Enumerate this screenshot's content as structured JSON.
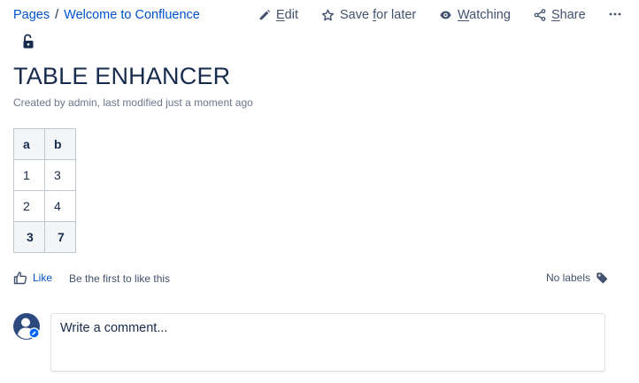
{
  "breadcrumb": {
    "root": "Pages",
    "separator": "/",
    "parent": "Welcome to Confluence"
  },
  "actions": {
    "edit": {
      "icon": "pencil-icon",
      "prefix": "",
      "underline": "E",
      "suffix": "dit"
    },
    "save": {
      "icon": "star-icon",
      "prefix": "Save ",
      "underline": "f",
      "suffix": "or later"
    },
    "watch": {
      "icon": "eye-icon",
      "prefix": "",
      "underline": "W",
      "suffix": "atching"
    },
    "share": {
      "icon": "share-icon",
      "prefix": "",
      "underline": "S",
      "suffix": "hare"
    },
    "more": {
      "icon": "more-icon",
      "label": "•••"
    }
  },
  "restriction_icon": "unlock-icon",
  "page": {
    "title": "TABLE ENHANCER",
    "byline": "Created by admin, last modified just a moment ago"
  },
  "table": {
    "headers": [
      "a",
      "b"
    ],
    "rows": [
      [
        "1",
        "3"
      ],
      [
        "2",
        "4"
      ]
    ],
    "totals": [
      "3",
      "7"
    ]
  },
  "like": {
    "label": "Like",
    "hint": "Be the first to like this",
    "icon": "thumbs-up-icon"
  },
  "labels": {
    "text": "No labels",
    "icon": "tag-icon"
  },
  "comment": {
    "placeholder": "Write a comment...",
    "avatar_icon": "user-avatar-icon"
  },
  "colors": {
    "link": "#0052cc",
    "text": "#172b4d",
    "muted": "#6b778c",
    "icon": "#42526e",
    "table_header_bg": "#f4f5f7",
    "table_border": "#c1c7d0"
  }
}
